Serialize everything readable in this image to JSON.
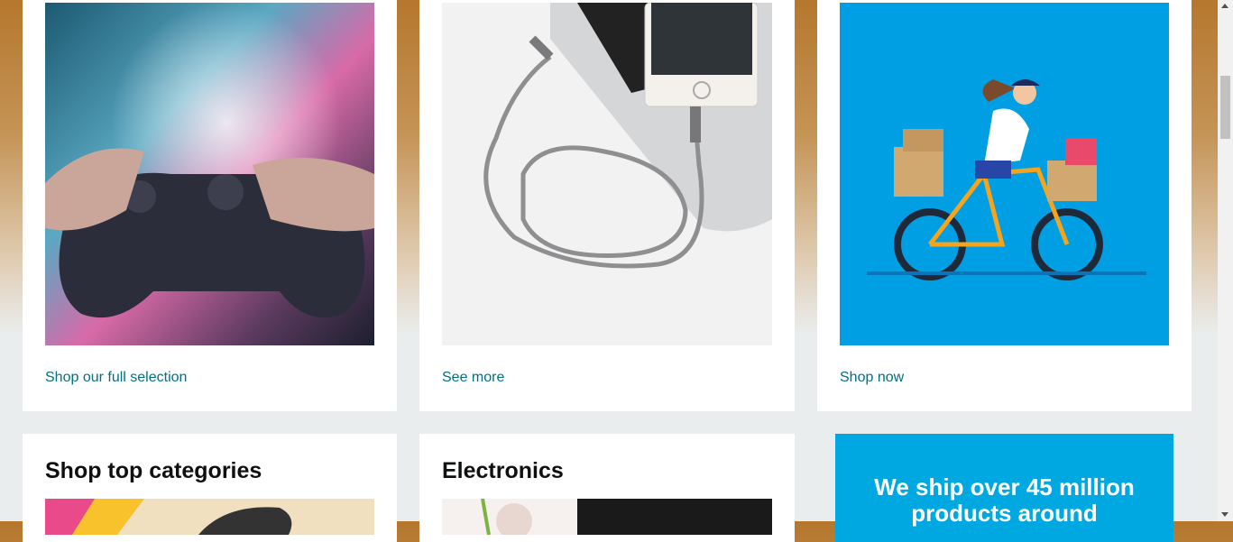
{
  "row1": [
    {
      "name": "gaming",
      "image_alt": "Hands holding a game controller",
      "link": "Shop our full selection"
    },
    {
      "name": "cable",
      "image_alt": "Braided charging cable connected to a phone on a laptop",
      "link": "See more"
    },
    {
      "name": "delivery",
      "image_alt": "Illustrated cyclist delivering boxes",
      "link": "Shop now"
    }
  ],
  "row2": {
    "categories_title": "Shop top categories",
    "electronics_title": "Electronics",
    "ad_lines": [
      "We ship over 45 million",
      "products around"
    ]
  },
  "colors": {
    "link": "#007185",
    "ad_bg": "#00a8e1",
    "page_bg": "#eaeded"
  }
}
